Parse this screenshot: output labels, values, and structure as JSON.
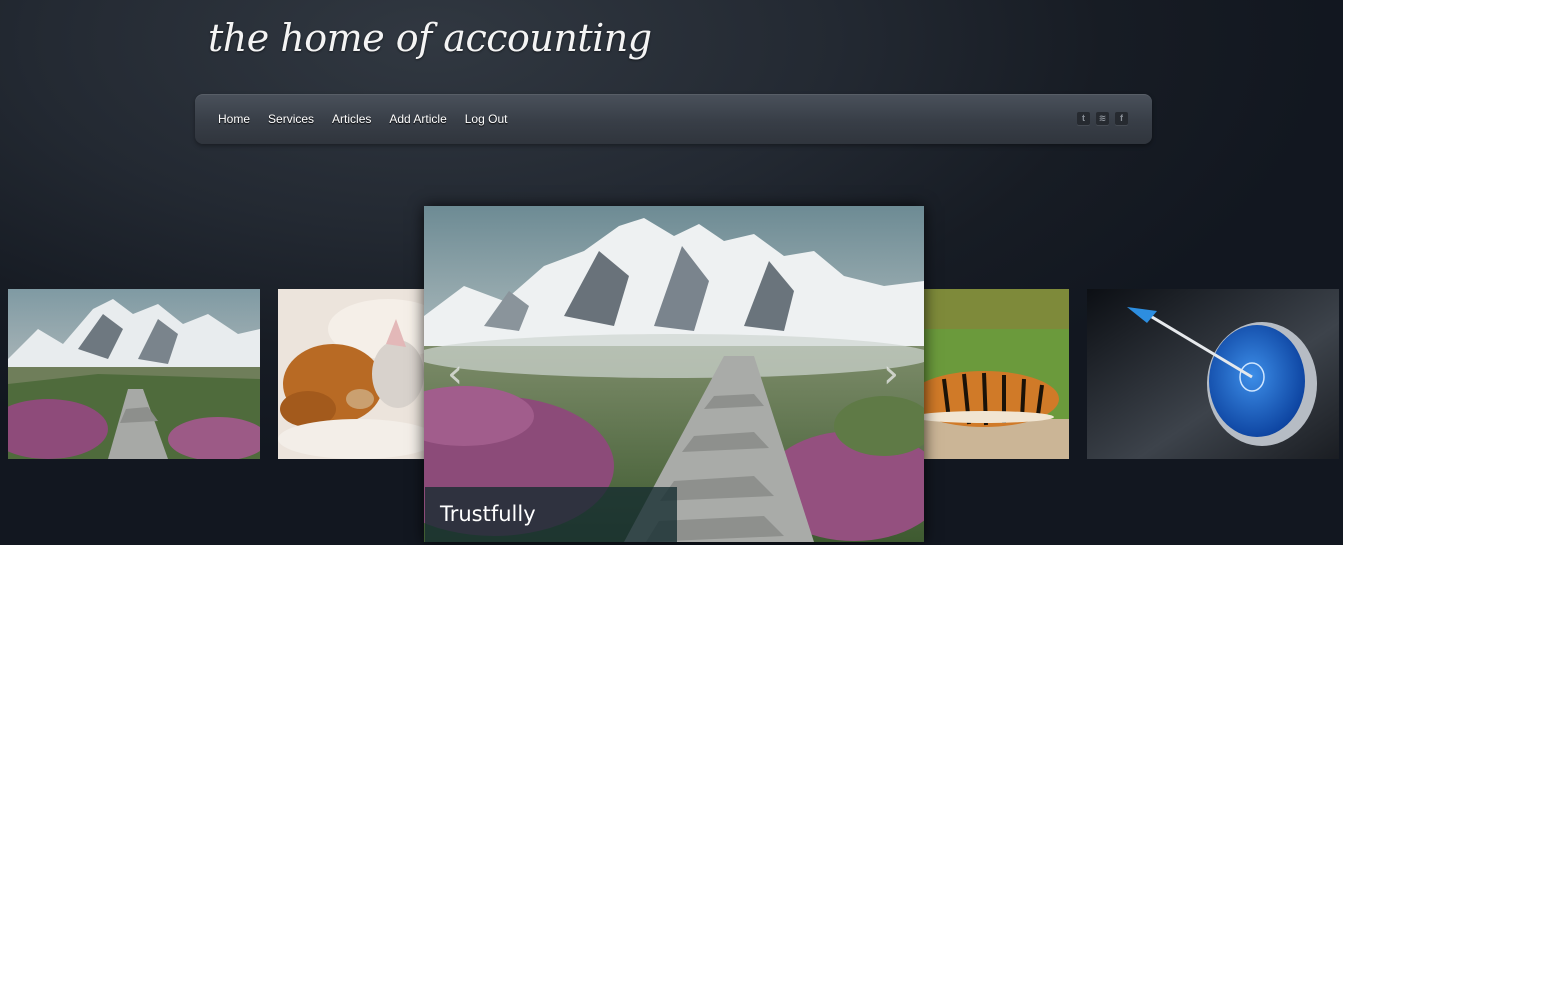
{
  "site": {
    "logo_text": "the home of accounting"
  },
  "nav": {
    "items": [
      {
        "label": "Home"
      },
      {
        "label": "Services"
      },
      {
        "label": "Articles"
      },
      {
        "label": "Add Article"
      },
      {
        "label": "Log Out"
      }
    ],
    "social_icons": [
      {
        "name": "twitter-icon",
        "glyph": "t"
      },
      {
        "name": "rss-icon",
        "glyph": "≋"
      },
      {
        "name": "facebook-icon",
        "glyph": "f"
      }
    ]
  },
  "carousel": {
    "active_caption": "Trustfully",
    "prev_glyph": "‹",
    "next_glyph": "›",
    "slides": [
      {
        "subject": "mountain-path"
      },
      {
        "subject": "puppy-and-kitten"
      },
      {
        "subject": "mountain-path",
        "active": true
      },
      {
        "subject": "sleeping-tiger"
      },
      {
        "subject": "arrow-in-target"
      }
    ]
  },
  "colors": {
    "background": "#161b23",
    "navbar": "#3a4049",
    "caption_bg": "#142c30",
    "text": "#ffffff"
  }
}
